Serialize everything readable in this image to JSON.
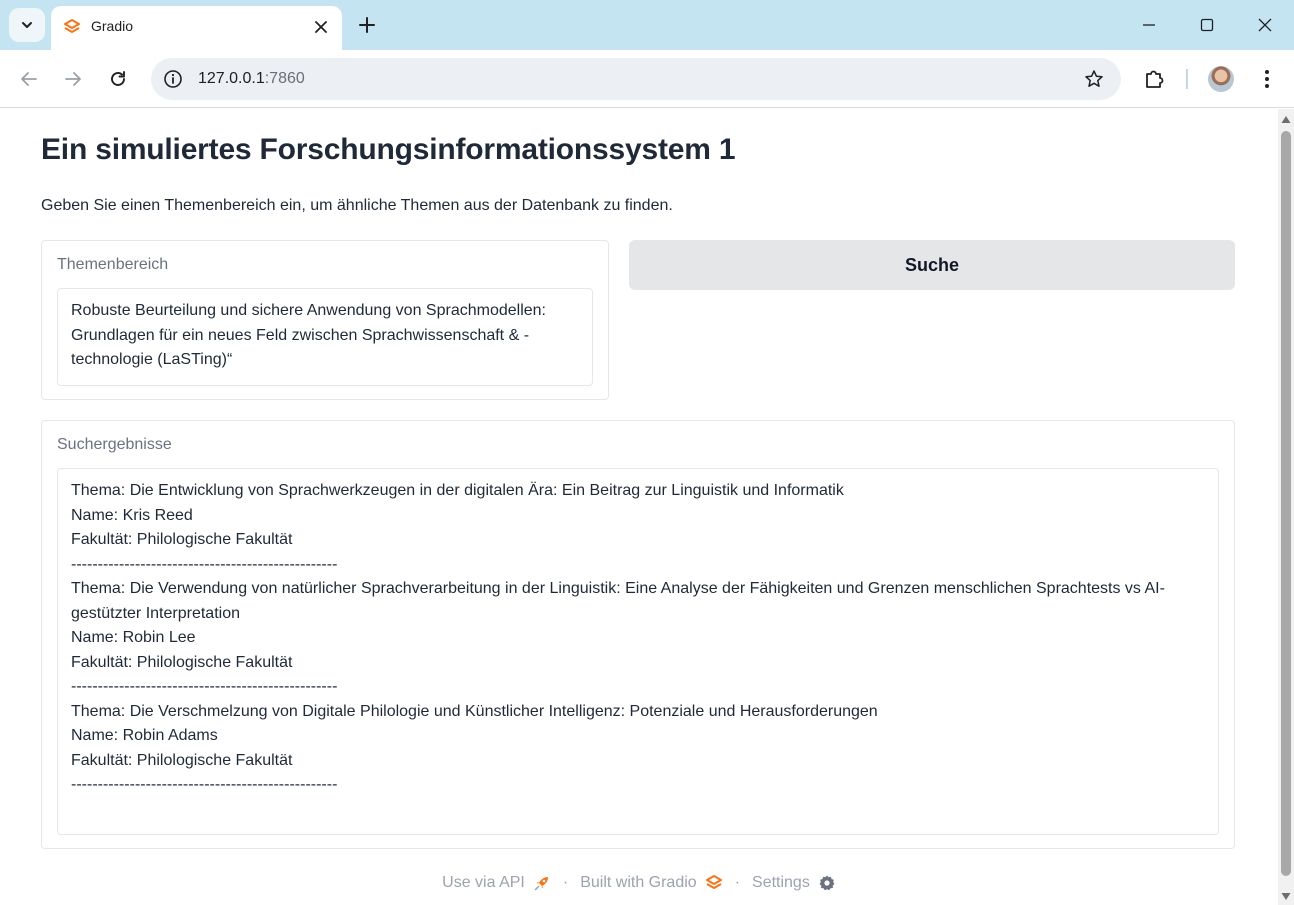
{
  "browser": {
    "tab_title": "Gradio",
    "url_host": "127.0.0.1",
    "url_port": ":7860"
  },
  "page": {
    "title": "Ein simuliertes Forschungsinformationssystem 1",
    "description": "Geben Sie einen Themenbereich ein, um ähnliche Themen aus der Datenbank zu finden.",
    "input_label": "Themenbereich",
    "input_value": "Robuste Beurteilung und sichere Anwendung von Sprachmodellen: Grundlagen für ein neues Feld zwischen Sprachwissenschaft & -technologie (LaSTing)“",
    "search_button": "Suche",
    "results_label": "Suchergebnisse",
    "results_value": "Thema: Die Entwicklung von Sprachwerkzeugen in der digitalen Ära: Ein Beitrag zur Linguistik und Informatik\nName: Kris Reed\nFakultät: Philologische Fakultät\n--------------------------------------------------\nThema: Die Verwendung von natürlicher Sprachverarbeitung in der Linguistik: Eine Analyse der Fähigkeiten und Grenzen menschlichen Sprachtests vs AI-gestützter Interpretation\nName: Robin Lee\nFakultät: Philologische Fakultät\n--------------------------------------------------\nThema: Die Verschmelzung von Digitale Philologie und Künstlicher Intelligenz: Potenziale und Herausforderungen\nName: Robin Adams\nFakultät: Philologische Fakultät\n--------------------------------------------------"
  },
  "footer": {
    "api_label": "Use via API",
    "built_label": "Built with Gradio",
    "settings_label": "Settings",
    "separator": "·"
  },
  "icons": {
    "favicon": "gradio-logo-icon",
    "rocket": "rocket-icon",
    "gear": "gear-icon"
  },
  "colors": {
    "gradio_orange": "#f97316",
    "tabbar_bg": "#c3e4f0",
    "button_bg": "#e5e6e8"
  }
}
